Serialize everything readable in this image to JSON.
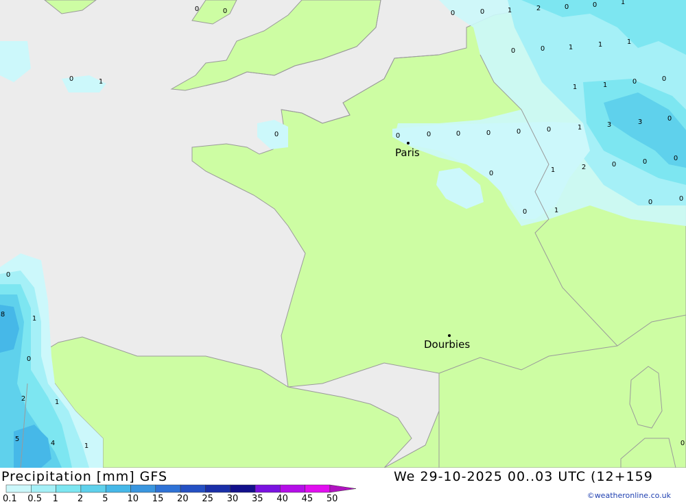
{
  "map": {
    "cities": [
      {
        "name": "Paris"
      },
      {
        "name": "Dourbies"
      }
    ],
    "grid_values": [
      "0",
      "0",
      "0",
      "0",
      "1",
      "2",
      "0",
      "0",
      "1",
      "0",
      "0",
      "1",
      "1",
      "1",
      "0",
      "1",
      "1",
      "1",
      "0",
      "0",
      "0",
      "0",
      "0",
      "0",
      "0",
      "0",
      "0",
      "1",
      "3",
      "3",
      "0",
      "0",
      "1",
      "2",
      "0",
      "0",
      "0",
      "0",
      "1",
      "0",
      "0",
      "0",
      "8",
      "1",
      "0",
      "2",
      "1",
      "5",
      "4",
      "1",
      "0"
    ]
  },
  "footer": {
    "title": "Precipitation [mm] GFS",
    "datetime": "We 29-10-2025 00..03 UTC (12+159",
    "credit": "©weatheronline.co.uk"
  },
  "legend": {
    "labels": [
      "0.1",
      "0.5",
      "1",
      "2",
      "5",
      "10",
      "15",
      "20",
      "25",
      "30",
      "35",
      "40",
      "45",
      "50"
    ],
    "colors": [
      "#ccf8fb",
      "#a5f0f7",
      "#7de6f1",
      "#5fd1ec",
      "#46b8e8",
      "#3a96df",
      "#2f72d6",
      "#2450c3",
      "#1a2fa8",
      "#12108b",
      "#7a12e0",
      "#b40ee8",
      "#e10ef0",
      "#b012c0"
    ]
  },
  "colors": {
    "sea": "#ececec",
    "land": "#cdfda3",
    "border": "#9a9a9a",
    "credit": "#1e3fb0"
  }
}
